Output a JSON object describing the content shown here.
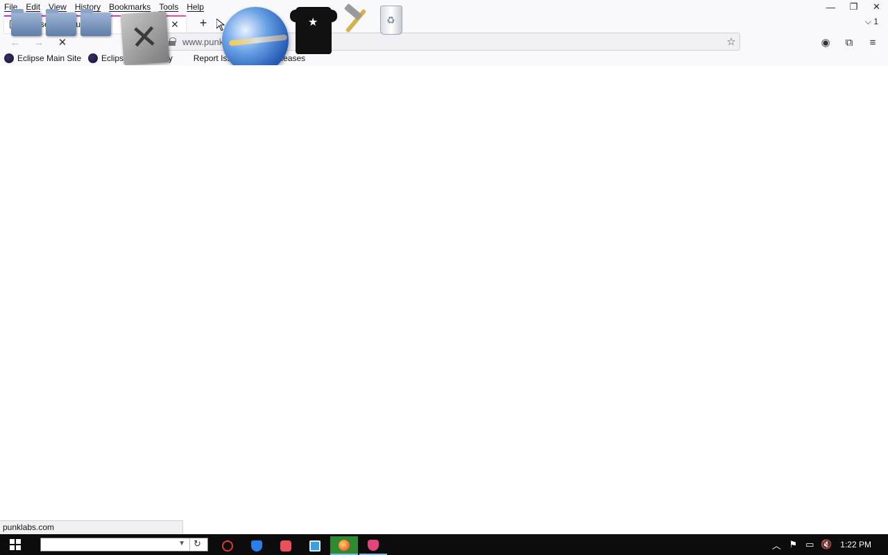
{
  "menubar": {
    "items": [
      "File",
      "Edit",
      "View",
      "History",
      "Bookmarks",
      "Tools",
      "Help"
    ]
  },
  "window": {
    "minimize_glyph": "—",
    "restore_glyph": "❐",
    "close_glyph": "✕"
  },
  "tab": {
    "title": "Eclipse Community",
    "close_glyph": "✕"
  },
  "tabbar": {
    "new_tab_glyph": "+",
    "tab_list_label": "⌵ 1"
  },
  "nav": {
    "back_glyph": "←",
    "forward_glyph": "→",
    "stop_glyph": "✕",
    "url": "www.punklabs.com",
    "star_glyph": "☆",
    "account_glyph": "◉",
    "extensions_glyph": "⧉",
    "menu_glyph": "≡"
  },
  "bookmarks": [
    {
      "label": "Eclipse Main Site",
      "icon": "eclipse-icon"
    },
    {
      "label": "Eclipse Community",
      "icon": "eclipse-icon"
    },
    {
      "label": "Report Issues",
      "icon": "none"
    },
    {
      "label": "New Releases",
      "icon": "none"
    }
  ],
  "desktop_overlay_icons": [
    "folder-icon",
    "folder-icon",
    "folder-icon",
    "tools-icon",
    "globe-icon",
    "tshirt-icon",
    "hammer-icon",
    "recycle-bin-icon"
  ],
  "status": {
    "text": "punklabs.com"
  },
  "taskbar": {
    "search_value": "",
    "icons": [
      "stop-icon",
      "shield-icon",
      "camera-icon",
      "window-icon",
      "firefox-icon",
      "cat-icon"
    ],
    "tray": {
      "chevron_glyph": "︿",
      "flag_glyph": "⚑",
      "network_glyph": "▭",
      "volume_glyph": "🔇",
      "time": "1:22 PM"
    }
  },
  "colors": {
    "tab_accent_start": "#b833e1",
    "tab_accent_end": "#e44fa6",
    "taskbar_bg": "#0c0c0c",
    "taskbar_active": "#76b9ed"
  }
}
